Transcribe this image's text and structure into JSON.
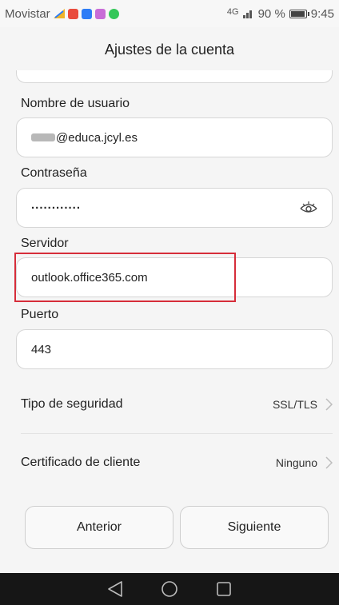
{
  "status_bar": {
    "carrier": "Movistar",
    "network": "4G",
    "battery": "90 %",
    "time": "9:45",
    "notification_colors": [
      "#e94b3c",
      "#2d7cf6",
      "#c86dd7",
      "#34c759"
    ]
  },
  "title": "Ajustes de la cuenta",
  "fields": {
    "username": {
      "label": "Nombre de usuario",
      "value": "@educa.jcyl.es"
    },
    "password": {
      "label": "Contraseña",
      "value": "............"
    },
    "server": {
      "label": "Servidor",
      "value": "outlook.office365.com"
    },
    "port": {
      "label": "Puerto",
      "value": "443"
    }
  },
  "settings": {
    "security": {
      "label": "Tipo de seguridad",
      "value": "SSL/TLS"
    },
    "client_cert": {
      "label": "Certificado de cliente",
      "value": "Ninguno"
    }
  },
  "buttons": {
    "previous": "Anterior",
    "next": "Siguiente"
  },
  "colors": {
    "highlight": "#d62d3a",
    "nav_bar": "#161616"
  },
  "icons": [
    "eye-icon",
    "chevron-right-icon",
    "back-icon",
    "home-icon",
    "recents-icon"
  ]
}
